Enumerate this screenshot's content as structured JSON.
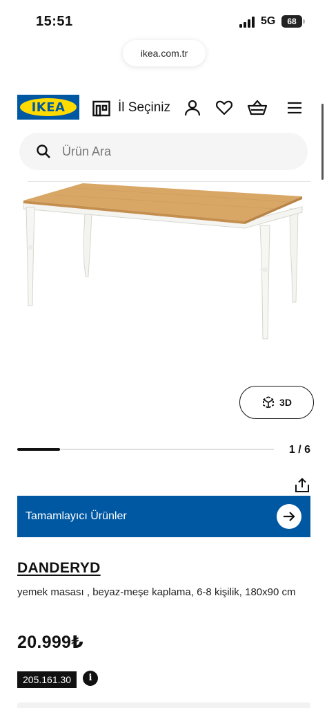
{
  "status_bar": {
    "time": "15:51",
    "network": "5G",
    "battery": "68"
  },
  "browser": {
    "url": "ikea.com.tr"
  },
  "header": {
    "logo_text": "IKEA",
    "store_label": "İl Seçiniz",
    "icons": [
      "store-icon",
      "profile-icon",
      "heart-icon",
      "basket-icon",
      "menu-icon"
    ]
  },
  "search": {
    "placeholder": "Ürün Ara",
    "value": ""
  },
  "gallery": {
    "view_3d_label": "3D",
    "counter": "1 / 6",
    "progress": 0.167
  },
  "banner": {
    "label": "Tamamlayıcı Ürünler"
  },
  "product": {
    "name": "DANDERYD",
    "description": "yemek masası , beyaz-meşe kaplama, 6-8 kişilik, 180x90 cm",
    "price": "20.999₺",
    "article_number": "205.161.30"
  },
  "colors": {
    "brand_blue": "#0058a3",
    "brand_yellow": "#ffdb00",
    "tabletop": "#d9a765",
    "legs": "#f4f4f1"
  }
}
